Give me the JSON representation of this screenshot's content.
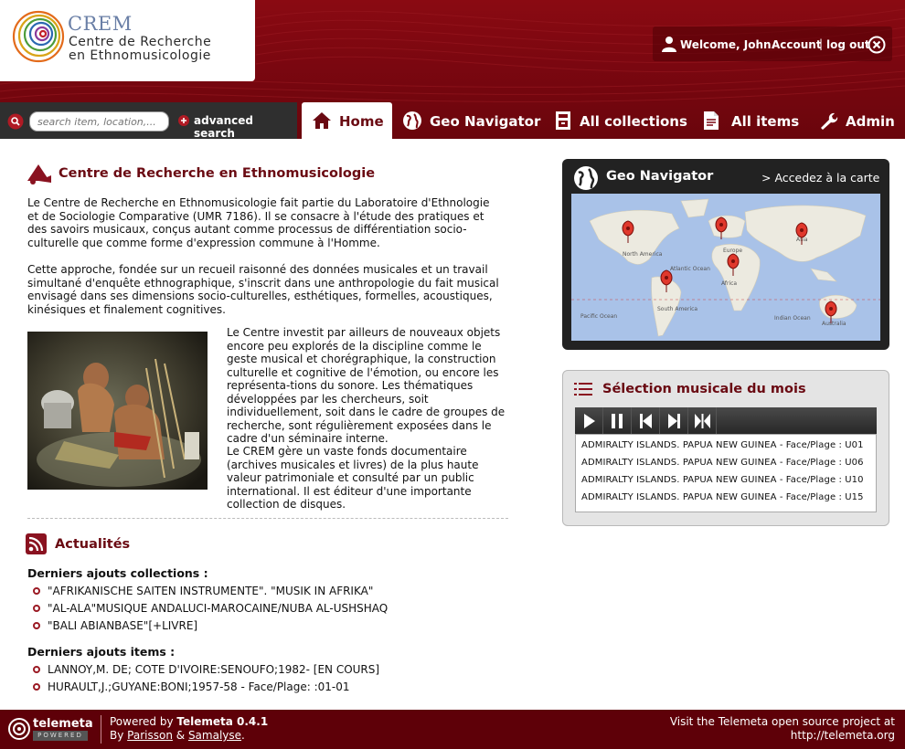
{
  "header": {
    "logo": {
      "acronym": "CREM",
      "line1": "Centre de Recherche",
      "line2": "en Ethnomusicologie"
    },
    "user": {
      "welcome": "Welcome, John.",
      "account": "Account",
      "separator": "|",
      "logout": "log out"
    }
  },
  "search": {
    "placeholder": "search item, location,...",
    "advanced": "advanced search"
  },
  "nav": {
    "tabs": [
      {
        "label": "Home",
        "icon": "home-icon",
        "active": true
      },
      {
        "label": "Geo Navigator",
        "icon": "globe-icon"
      },
      {
        "label": "All collections",
        "icon": "collections-icon"
      },
      {
        "label": "All items",
        "icon": "items-icon"
      },
      {
        "label": "Admin",
        "icon": "wrench-icon"
      }
    ]
  },
  "intro": {
    "title": "Centre de Recherche en Ethnomusicologie",
    "p1": "Le Centre de Recherche en Ethnomusicologie fait partie du Laboratoire d'Ethnologie et de Sociologie Comparative (UMR 7186). Il se consacre à l'étude des pratiques et des savoirs musicaux, conçus autant comme processus de différentiation socio-culturelle que comme forme d'expression commune à l'Homme.",
    "p2": "Cette approche, fondée sur un recueil raisonné des données musicales et un travail simultané d'enquête ethnographique, s'inscrit dans une anthropologie du fait musical envisagé dans ses dimensions socio-culturelles, esthétiques, formelles, acoustiques, kinésiques et finalement cognitives.",
    "p3": "Le Centre investit par ailleurs de nouveaux objets encore peu explorés de la discipline comme le geste musical et chorégraphique, la construction culturelle et cognitive de l'émotion, ou encore les représenta-tions du sonore. Les thématiques développées par les chercheurs, soit individuellement, soit dans le cadre de groupes de recherche, sont régulièrement exposées dans le cadre d'un séminaire interne.",
    "p4": "Le CREM gère un vaste fonds documentaire (archives musicales et livres) de la plus haute valeur patrimoniale et consulté par un public international. Il est éditeur d'une importante collection de disques."
  },
  "news": {
    "title": "Actualités",
    "collections_head": "Derniers ajouts collections :",
    "collections": [
      "\"AFRIKANISCHE SAITEN INSTRUMENTE\". \"MUSIK IN AFRIKA\"",
      "\"AL-ALA\"MUSIQUE ANDALUCI-MAROCAINE/NUBA AL-USHSHAQ",
      "\"BALI ABIANBASE\"[+LIVRE]"
    ],
    "items_head": "Derniers ajouts items :",
    "items": [
      "LANNOY,M. DE; COTE D'IVOIRE:SENOUFO;1982- [EN COURS]",
      "HURAULT,J.;GUYANE:BONI;1957-58 - Face/Plage: :01-01"
    ]
  },
  "geo": {
    "title": "Geo Navigator",
    "link": "> Accedez à la carte",
    "map_labels": [
      "North America",
      "Europe",
      "Asia",
      "Atlantic Ocean",
      "Africa",
      "South America",
      "Pacific Ocean",
      "Indian Ocean",
      "Australia"
    ]
  },
  "music": {
    "title": "Sélection musicale du mois",
    "controls": [
      "play-icon",
      "pause-icon",
      "previous-icon",
      "next-icon",
      "stop-icon"
    ],
    "playlist": [
      "ADMIRALTY ISLANDS. PAPUA NEW GUINEA - Face/Plage : U01",
      "ADMIRALTY ISLANDS. PAPUA NEW GUINEA - Face/Plage : U06",
      "ADMIRALTY ISLANDS. PAPUA NEW GUINEA - Face/Plage : U10",
      "ADMIRALTY ISLANDS. PAPUA NEW GUINEA - Face/Plage : U15"
    ]
  },
  "footer": {
    "brand": "telemeta",
    "badge": "POWERED",
    "powered_prefix": "Powered by ",
    "powered_name": "Telemeta 0.4.1",
    "by_prefix": "By ",
    "by_1": "Parisson",
    "by_amp": " & ",
    "by_2": "Samalyse",
    "by_dot": ".",
    "visit": "Visit the Telemeta open source project at",
    "url": "http://telemeta.org"
  },
  "colors": {
    "brand_red": "#7b0710",
    "title_red": "#6a0a12",
    "nav_dark": "#2f2f2f"
  }
}
